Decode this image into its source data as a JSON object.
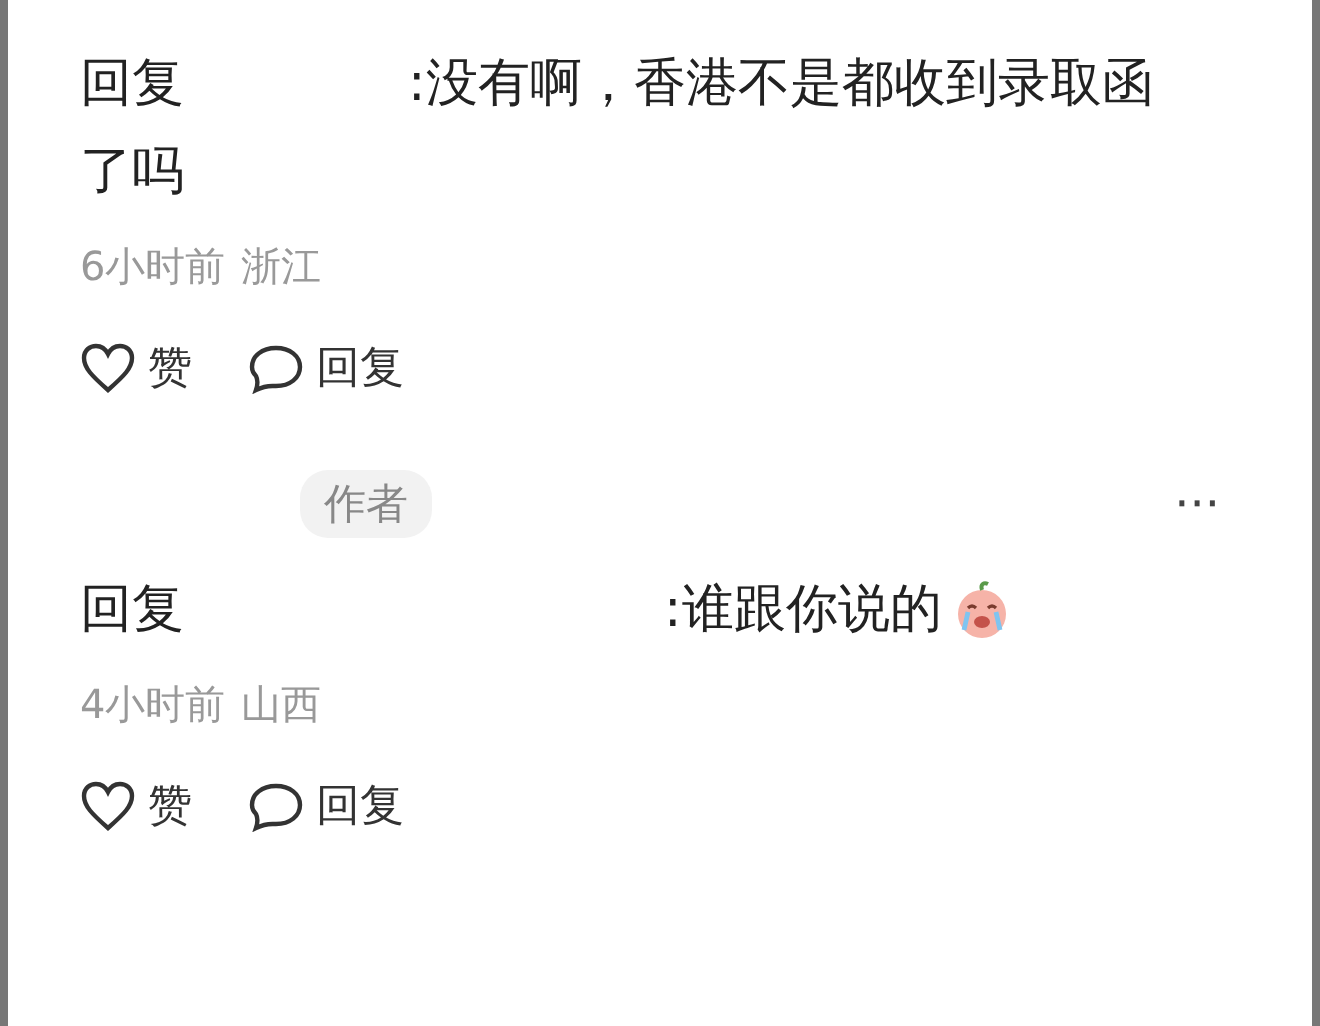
{
  "comments": [
    {
      "reply_label": "回复",
      "text": ":没有啊，香港不是都收到录取函了吗",
      "time": "6小时前",
      "location": "浙江",
      "actions": [
        {
          "kind": "like",
          "label": "赞"
        },
        {
          "kind": "reply",
          "label": "回复"
        }
      ]
    },
    {
      "author_badge": "作者",
      "more": "···",
      "reply_label": "回复",
      "text": ":谁跟你说的",
      "emoji": true,
      "time": "4小时前",
      "location": "山西",
      "actions": [
        {
          "kind": "like",
          "label": "赞"
        },
        {
          "kind": "reply",
          "label": "回复"
        }
      ]
    }
  ]
}
